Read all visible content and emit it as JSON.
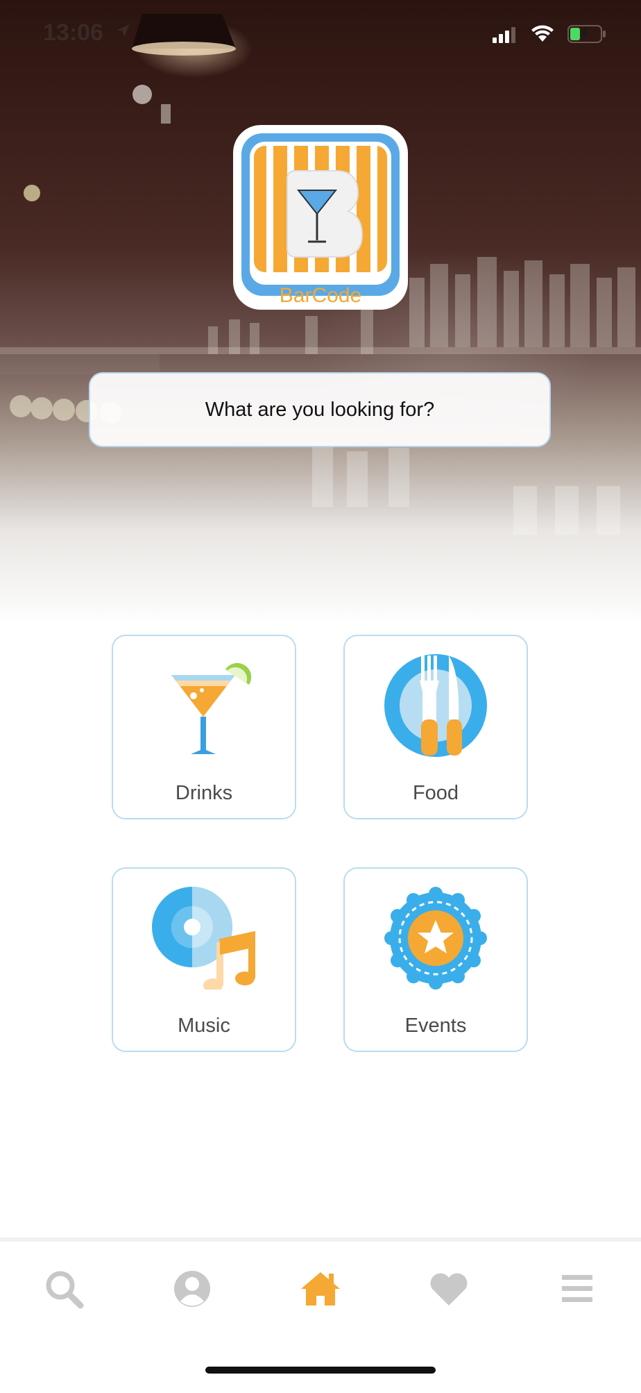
{
  "status_bar": {
    "time": "13:06"
  },
  "brand": {
    "name": "BarCode",
    "accent": "#f5a833",
    "blue": "#5aa9e6"
  },
  "search": {
    "prompt": "What are you looking for?"
  },
  "categories": [
    {
      "label": "Drinks",
      "icon": "cocktail-icon"
    },
    {
      "label": "Food",
      "icon": "fork-knife-plate-icon"
    },
    {
      "label": "Music",
      "icon": "music-disc-icon"
    },
    {
      "label": "Events",
      "icon": "star-badge-icon"
    }
  ],
  "tabbar": {
    "items": [
      {
        "name": "search",
        "icon": "search-icon"
      },
      {
        "name": "profile",
        "icon": "user-icon"
      },
      {
        "name": "home",
        "icon": "home-icon",
        "active": true
      },
      {
        "name": "favorites",
        "icon": "heart-icon"
      },
      {
        "name": "menu",
        "icon": "menu-icon"
      }
    ],
    "active_color": "#f5a833",
    "inactive_color": "#c8c8c8"
  }
}
